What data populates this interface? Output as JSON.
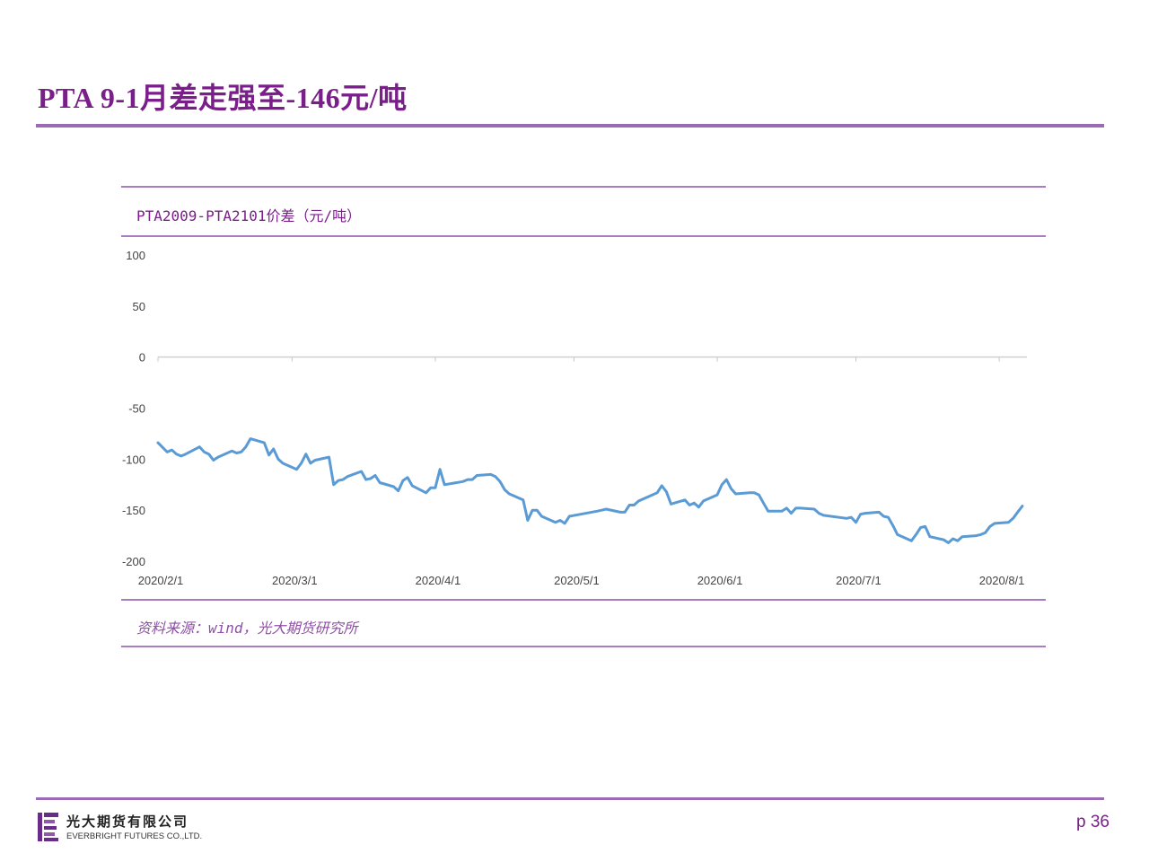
{
  "page": {
    "title": "PTA 9-1月差走强至-146元/吨",
    "page_number": "p 36",
    "accent_color": "#7a1f8a",
    "rule_color": "#9b6bb5",
    "line_color": "#5b9bd5"
  },
  "chart": {
    "caption": "PTA2009-PTA2101价差（元/吨）",
    "source": "资料来源：wind，光大期货研究所"
  },
  "footer": {
    "logo_icon": "everbright-logo-icon",
    "company_cn": "光大期货有限公司",
    "company_en": "EVERBRIGHT FUTURES CO.,LTD."
  },
  "chart_data": {
    "type": "line",
    "title": "PTA2009-PTA2101价差（元/吨）",
    "xlabel": "",
    "ylabel": "",
    "ylim": [
      -200,
      100
    ],
    "yticks": [
      100,
      50,
      0,
      -50,
      -100,
      -150,
      -200
    ],
    "xlim": [
      "2020-02-01",
      "2020-08-07"
    ],
    "xticks": [
      "2020-02-01",
      "2020-03-01",
      "2020-04-01",
      "2020-05-01",
      "2020-06-01",
      "2020-07-01",
      "2020-08-01"
    ],
    "xtick_labels": [
      "2020/2/1",
      "2020/3/1",
      "2020/4/1",
      "2020/5/1",
      "2020/6/1",
      "2020/7/1",
      "2020/8/1"
    ],
    "grid": false,
    "legend": "none",
    "series": [
      {
        "x": [
          "2020-02-01",
          "2020-02-03",
          "2020-02-04",
          "2020-02-05",
          "2020-02-06",
          "2020-02-07",
          "2020-02-10",
          "2020-02-11",
          "2020-02-12",
          "2020-02-13",
          "2020-02-14",
          "2020-02-17",
          "2020-02-18",
          "2020-02-19",
          "2020-02-20",
          "2020-02-21",
          "2020-02-24",
          "2020-02-25",
          "2020-02-26",
          "2020-02-27",
          "2020-02-28",
          "2020-03-02",
          "2020-03-03",
          "2020-03-04",
          "2020-03-05",
          "2020-03-06",
          "2020-03-09",
          "2020-03-10",
          "2020-03-11",
          "2020-03-12",
          "2020-03-13",
          "2020-03-16",
          "2020-03-17",
          "2020-03-18",
          "2020-03-19",
          "2020-03-20",
          "2020-03-23",
          "2020-03-24",
          "2020-03-25",
          "2020-03-26",
          "2020-03-27",
          "2020-03-30",
          "2020-03-31",
          "2020-04-01",
          "2020-04-02",
          "2020-04-03",
          "2020-04-07",
          "2020-04-08",
          "2020-04-09",
          "2020-04-10",
          "2020-04-13",
          "2020-04-14",
          "2020-04-15",
          "2020-04-16",
          "2020-04-17",
          "2020-04-20",
          "2020-04-21",
          "2020-04-22",
          "2020-04-23",
          "2020-04-24",
          "2020-04-27",
          "2020-04-28",
          "2020-04-29",
          "2020-04-30",
          "2020-05-06",
          "2020-05-07",
          "2020-05-08",
          "2020-05-11",
          "2020-05-12",
          "2020-05-13",
          "2020-05-14",
          "2020-05-15",
          "2020-05-18",
          "2020-05-19",
          "2020-05-20",
          "2020-05-21",
          "2020-05-22",
          "2020-05-25",
          "2020-05-26",
          "2020-05-27",
          "2020-05-28",
          "2020-05-29",
          "2020-06-01",
          "2020-06-02",
          "2020-06-03",
          "2020-06-04",
          "2020-06-05",
          "2020-06-08",
          "2020-06-09",
          "2020-06-10",
          "2020-06-11",
          "2020-06-12",
          "2020-06-15",
          "2020-06-16",
          "2020-06-17",
          "2020-06-18",
          "2020-06-19",
          "2020-06-22",
          "2020-06-23",
          "2020-06-24",
          "2020-06-29",
          "2020-06-30",
          "2020-07-01",
          "2020-07-02",
          "2020-07-03",
          "2020-07-06",
          "2020-07-07",
          "2020-07-08",
          "2020-07-09",
          "2020-07-10",
          "2020-07-13",
          "2020-07-14",
          "2020-07-15",
          "2020-07-16",
          "2020-07-17",
          "2020-07-20",
          "2020-07-21",
          "2020-07-22",
          "2020-07-23",
          "2020-07-24",
          "2020-07-27",
          "2020-07-28",
          "2020-07-29",
          "2020-07-30",
          "2020-07-31",
          "2020-08-03",
          "2020-08-04",
          "2020-08-05",
          "2020-08-06"
        ],
        "y": [
          -84,
          -93,
          -91,
          -95,
          -97,
          -95,
          -88,
          -93,
          -95,
          -101,
          -98,
          -92,
          -94,
          -93,
          -88,
          -80,
          -84,
          -96,
          -90,
          -100,
          -104,
          -110,
          -104,
          -95,
          -104,
          -101,
          -98,
          -125,
          -121,
          -120,
          -117,
          -112,
          -120,
          -119,
          -116,
          -123,
          -127,
          -131,
          -121,
          -118,
          -126,
          -133,
          -128,
          -128,
          -110,
          -125,
          -122,
          -120,
          -120,
          -116,
          -115,
          -117,
          -122,
          -130,
          -134,
          -140,
          -160,
          -150,
          -150,
          -156,
          -162,
          -160,
          -163,
          -156,
          -151,
          -150,
          -149,
          -152,
          -152,
          -145,
          -145,
          -141,
          -135,
          -133,
          -126,
          -132,
          -144,
          -140,
          -145,
          -143,
          -147,
          -141,
          -135,
          -125,
          -120,
          -129,
          -134,
          -133,
          -133,
          -135,
          -143,
          -151,
          -151,
          -148,
          -153,
          -148,
          -148,
          -149,
          -153,
          -155,
          -158,
          -157,
          -162,
          -154,
          -153,
          -152,
          -156,
          -157,
          -165,
          -174,
          -180,
          -174,
          -167,
          -166,
          -176,
          -179,
          -182,
          -178,
          -180,
          -176,
          -175,
          -174,
          -172,
          -166,
          -163,
          -162,
          -158,
          -152,
          -146
        ]
      }
    ]
  }
}
